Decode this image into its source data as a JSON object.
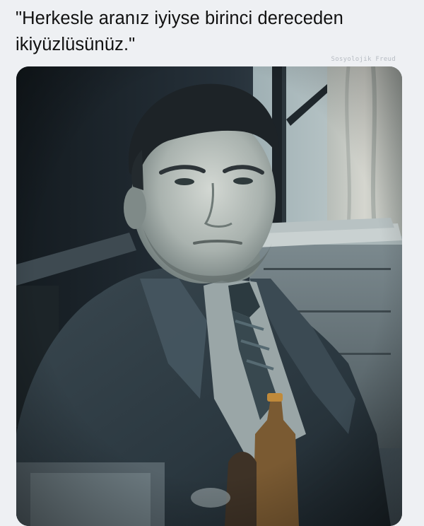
{
  "post": {
    "caption": "\"Herkesle aranız iyiyse birinci dereceden\nikiyüzlüsünüz.\"",
    "watermark": "Sosyolojik Freud"
  },
  "photo": {
    "subject": "man-in-suit-portrait",
    "tone": "desaturated-teal"
  }
}
